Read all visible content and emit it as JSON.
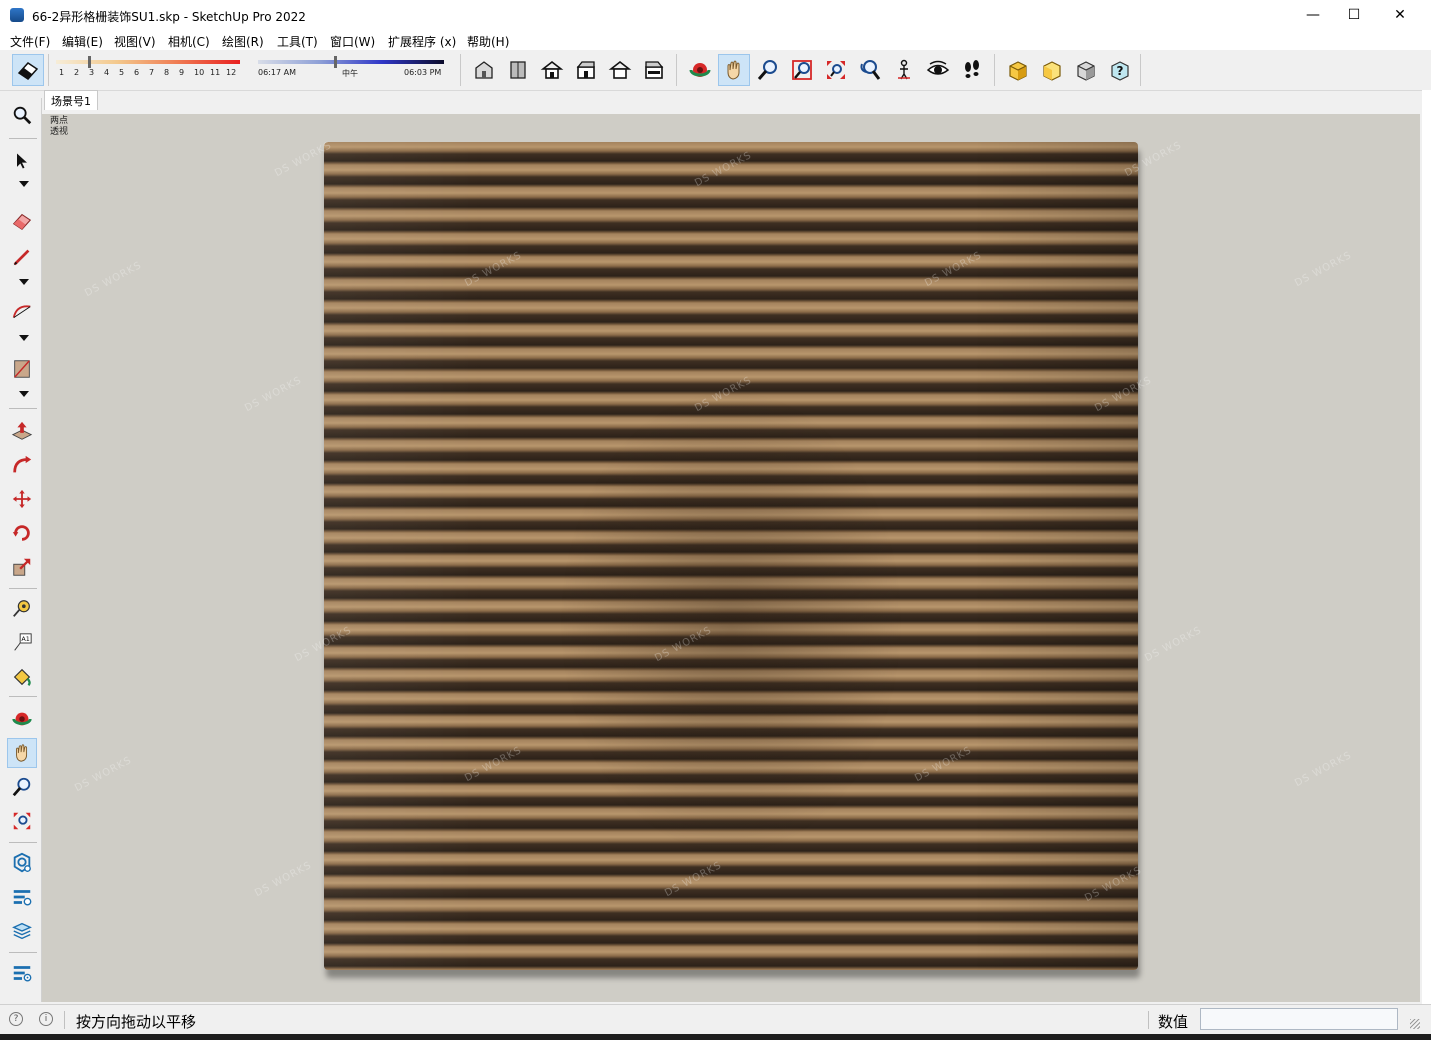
{
  "window": {
    "title": "66-2异形格栅装饰SU1.skp - SketchUp Pro 2022",
    "minimize": "—",
    "maximize": "☐",
    "close": "✕"
  },
  "menu": [
    "文件(F)",
    "编辑(E)",
    "视图(V)",
    "相机(C)",
    "绘图(R)",
    "工具(T)",
    "窗口(W)",
    "扩展程序 (x)",
    "帮助(H)"
  ],
  "shadow": {
    "months": [
      "1",
      "2",
      "3",
      "4",
      "5",
      "6",
      "7",
      "8",
      "9",
      "10",
      "11",
      "12"
    ],
    "time_start": "06:17 AM",
    "time_mid": "中午",
    "time_end": "06:03 PM"
  },
  "toolbar_icons": [
    "eraser-icon",
    "house-iso-icon",
    "house-top-icon",
    "house-front-icon",
    "house-right-icon",
    "house-back-icon",
    "house-left-icon",
    "orbit-icon",
    "pan-icon",
    "zoom-icon",
    "zoom-window-icon",
    "zoom-extents-icon",
    "previous-view-icon",
    "position-camera-icon",
    "look-around-icon",
    "walk-icon",
    "section-box-icon",
    "section-plane-icon",
    "component-icon",
    "help-icon"
  ],
  "scene_tab": "场景号1",
  "viewport": {
    "label_line1": "两点",
    "label_line2": "透视",
    "watermark": "DS WORKS"
  },
  "status": {
    "text": "按方向拖动以平移",
    "measure_label": "数值",
    "measure_value": ""
  },
  "colors": {
    "viewport_bg": "#cfcdc6",
    "wood_light": "#b8966d",
    "wood_dark": "#2d2219",
    "active_tool": "#cde4f7"
  }
}
